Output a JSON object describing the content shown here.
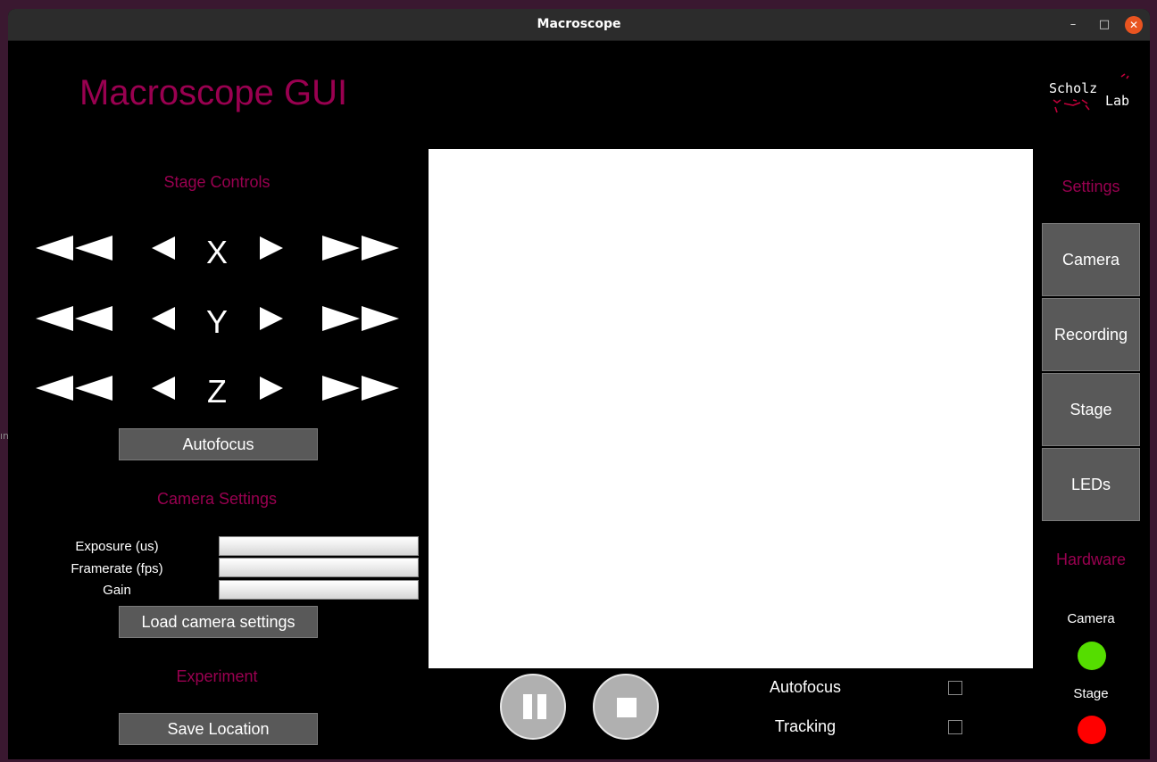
{
  "window": {
    "title": "Macroscope",
    "minimize": "–",
    "maximize": "□",
    "close": "✕"
  },
  "app_title": "Macroscope GUI",
  "logo": {
    "line1": "Scholz",
    "line2": "Lab"
  },
  "stage_controls": {
    "heading": "Stage Controls",
    "axes": [
      "X",
      "Y",
      "Z"
    ],
    "autofocus_label": "Autofocus"
  },
  "camera_settings": {
    "heading": "Camera Settings",
    "fields": [
      {
        "label": "Exposure (us)",
        "value": ""
      },
      {
        "label": "Framerate (fps)",
        "value": ""
      },
      {
        "label": "Gain",
        "value": ""
      }
    ],
    "load_label": "Load camera settings"
  },
  "experiment": {
    "heading": "Experiment",
    "save_label": "Save Location"
  },
  "playback": {
    "pause_icon": "pause-icon",
    "stop_icon": "stop-icon"
  },
  "toggles": [
    {
      "label": "Autofocus",
      "checked": false
    },
    {
      "label": "Tracking",
      "checked": false
    }
  ],
  "settings": {
    "heading": "Settings",
    "buttons": [
      "Camera",
      "Recording",
      "Stage",
      "LEDs"
    ]
  },
  "hardware": {
    "heading": "Hardware",
    "items": [
      {
        "label": "Camera",
        "status_color": "#55dd00"
      },
      {
        "label": "Stage",
        "status_color": "#ff0000"
      }
    ]
  },
  "colors": {
    "accent": "#990050",
    "button": "#595959"
  }
}
